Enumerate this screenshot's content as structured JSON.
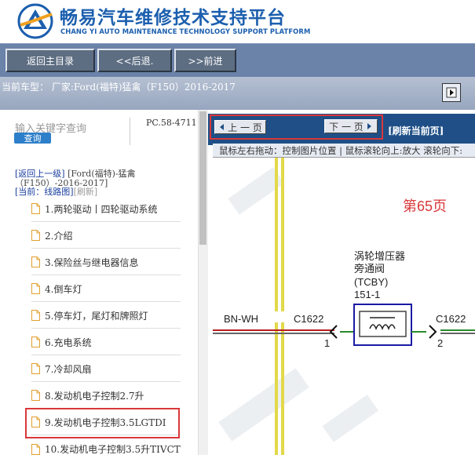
{
  "header": {
    "title": "畅易汽车维修技术支持平台",
    "subtitle": "CHANG YI AUTO MAINTENANCE TECHNOLOGY SUPPORT PLATFORM"
  },
  "toolbar": {
    "home": "返回主目录",
    "back": "<<后退.",
    "forward": ">>前进"
  },
  "vehicle": {
    "label": "当前车型：  厂家:Ford(福特)猛禽（F150）2016-2017"
  },
  "search": {
    "placeholder": "输入关键字查询",
    "button": "查询",
    "code": "PC.58-4711"
  },
  "nav": {
    "up_link": "[返回上一级]",
    "model": "[Ford(福特)-猛禽",
    "years": "（F150）-2016-2017]",
    "current_prefix": "[当前：",
    "current_name": "线路图",
    "current_suffix": "]",
    "refresh": "[刷新]"
  },
  "toc": [
    "1.两轮驱动丨四轮驱动系统",
    "2.介绍",
    "3.保险丝与继电器信息",
    "4.倒车灯",
    "5.停车灯，尾灯和牌照灯",
    "6.充电系统",
    "7.冷却风扇",
    "8.发动机电子控制2.7升",
    "9.发动机电子控制3.5LGTDI",
    "10.发动机电子控制3.5升TIVCT"
  ],
  "viewer": {
    "prev": "上 一 页",
    "next": "下 一 页",
    "refresh": "[刷新当前页]",
    "hint": "鼠标左右拖动：控制图片位置 | 鼠标滚轮向上:放大   滚轮向下:"
  },
  "diagram": {
    "page_label": "第65页",
    "component_name": "涡轮增压器",
    "component_line2": "旁通阀",
    "component_code": "(TCBY)",
    "component_ref": "151-1",
    "wire_left": "BN-WH",
    "conn_left": "C1622",
    "pin_left": "1",
    "conn_right": "C1622",
    "pin_right": "2",
    "page_color": "#d9383a"
  },
  "colors": {
    "brand": "#1c5fae",
    "toolbar": "#6b82a9",
    "highlight": "#d9383a"
  }
}
